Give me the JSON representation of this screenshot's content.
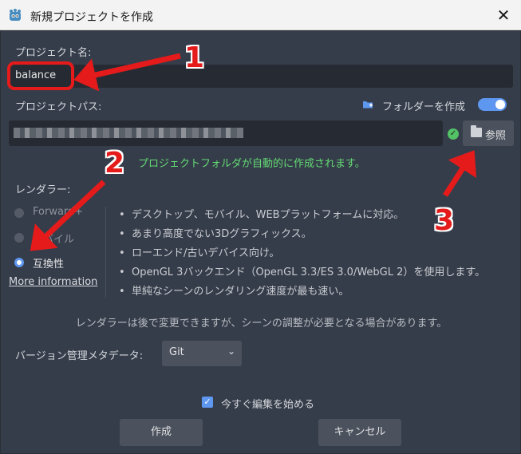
{
  "window": {
    "title": "新規プロジェクトを作成",
    "close_glyph": "✕"
  },
  "project_name": {
    "label": "プロジェクト名:",
    "value": "balance"
  },
  "project_path": {
    "label": "プロジェクトパス:",
    "create_folder_label": "フォルダーを作成",
    "create_folder_on": true,
    "browse_label": "参照",
    "status_message": "プロジェクトフォルダが自動的に作成されます。"
  },
  "renderer": {
    "label": "レンダラー:",
    "options": [
      "Forward+",
      "モバイル",
      "互換性"
    ],
    "selected": "互換性",
    "more_info": "More information",
    "bullets": [
      "デスクトップ、モバイル、WEBプラットフォームに対応。",
      "あまり高度でない3Dグラフィックス。",
      "ローエンド/古いデバイス向け。",
      "OpenGL 3バックエンド（OpenGL 3.3/ES 3.0/WebGL 2）を使用します。",
      "単純なシーンのレンダリング速度が最も速い。"
    ],
    "notice": "レンダラーは後で変更できますが、シーンの調整が必要となる場合があります。"
  },
  "vcs": {
    "label": "バージョン管理メタデータ:",
    "value": "Git"
  },
  "start_editing": {
    "label": "今すぐ編集を始める",
    "checked": true
  },
  "buttons": {
    "create": "作成",
    "cancel": "キャンセル"
  },
  "annotations": {
    "numbers": [
      "1",
      "2",
      "3"
    ],
    "color": "#e51b1b"
  },
  "colors": {
    "accent": "#5e97f0",
    "success": "#63db74",
    "dialog_bg": "#363d4a"
  }
}
